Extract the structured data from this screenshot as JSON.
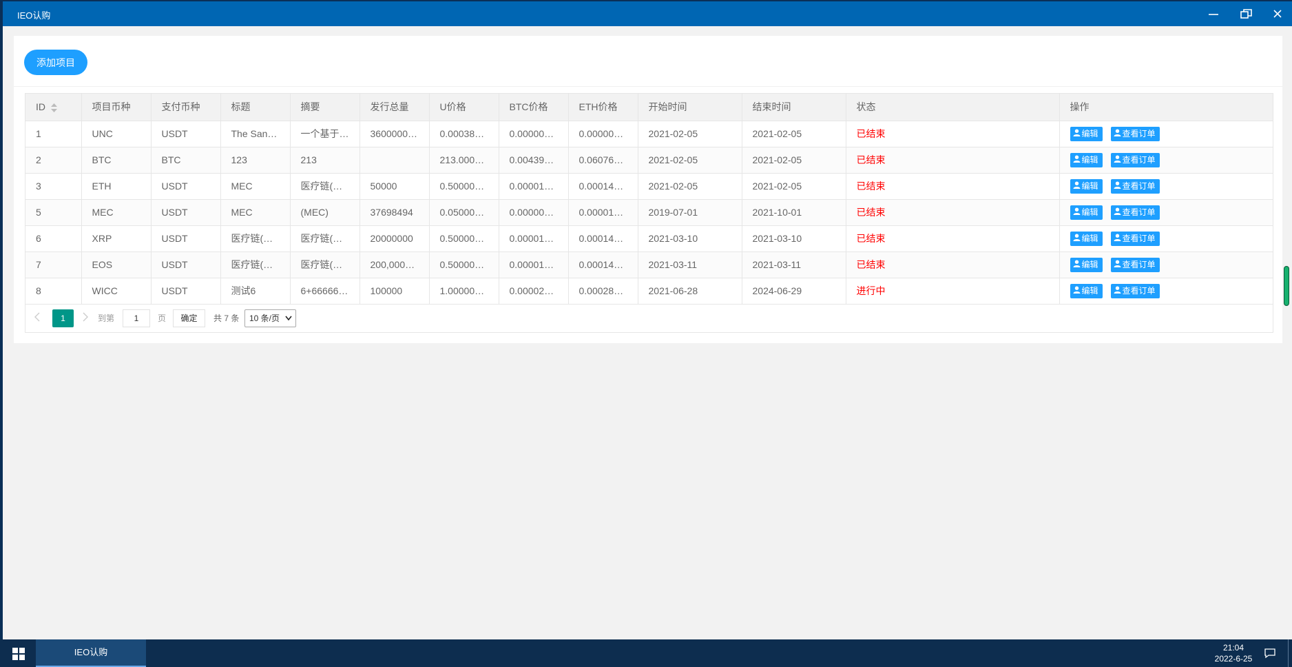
{
  "window": {
    "title": "IEO认购"
  },
  "toolbar": {
    "add_label": "添加项目"
  },
  "table": {
    "headers": [
      "ID",
      "项目币种",
      "支付币种",
      "标题",
      "摘要",
      "发行总量",
      "U价格",
      "BTC价格",
      "ETH价格",
      "开始时间",
      "结束时间",
      "状态",
      "操作"
    ],
    "rows": [
      [
        "1",
        "UNC",
        "USDT",
        "The San…",
        "一个基于…",
        "3600000…",
        "0.00038…",
        "0.00000…",
        "0.00000…",
        "2021-02-05",
        "2021-02-05",
        "已结束"
      ],
      [
        "2",
        "BTC",
        "BTC",
        "123",
        "213",
        "",
        "213.000…",
        "0.00439…",
        "0.06076…",
        "2021-02-05",
        "2021-02-05",
        "已结束"
      ],
      [
        "3",
        "ETH",
        "USDT",
        "MEC",
        "医疗链(…",
        "50000",
        "0.50000…",
        "0.00001…",
        "0.00014…",
        "2021-02-05",
        "2021-02-05",
        "已结束"
      ],
      [
        "5",
        "MEC",
        "USDT",
        "MEC",
        "(MEC)",
        "37698494",
        "0.05000…",
        "0.00000…",
        "0.00001…",
        "2019-07-01",
        "2021-10-01",
        "已结束"
      ],
      [
        "6",
        "XRP",
        "USDT",
        "医疗链(…",
        "医疗链(…",
        "20000000",
        "0.50000…",
        "0.00001…",
        "0.00014…",
        "2021-03-10",
        "2021-03-10",
        "已结束"
      ],
      [
        "7",
        "EOS",
        "USDT",
        "医疗链(…",
        "医疗链(…",
        "200,000…",
        "0.50000…",
        "0.00001…",
        "0.00014…",
        "2021-03-11",
        "2021-03-11",
        "已结束"
      ],
      [
        "8",
        "WICC",
        "USDT",
        "测试6",
        "6+66666…",
        "100000",
        "1.00000…",
        "0.00002…",
        "0.00028…",
        "2021-06-28",
        "2024-06-29",
        "进行中"
      ]
    ],
    "action_edit": "编辑",
    "action_orders": "查看订单"
  },
  "pagination": {
    "current_page": "1",
    "goto_label": "到第",
    "goto_value": "1",
    "page_label": "页",
    "confirm_label": "确定",
    "total_label": "共 7 条",
    "page_size": "10 条/页"
  },
  "taskbar": {
    "app_label": "IEO认购",
    "time": "21:04",
    "date": "2022-6-25"
  },
  "colors": {
    "titlebar": "#0066b3",
    "primary_button": "#1e9fff",
    "status_red": "#ff0000",
    "page_active": "#009688",
    "taskbar": "#0d2d4f"
  },
  "icons": {
    "minimize": "minimize-icon",
    "maximize": "restore-icon",
    "close": "close-icon",
    "sort": "sort-icon",
    "user": "user-icon",
    "prev": "chevron-left-icon",
    "next": "chevron-right-icon",
    "start": "windows-start-icon",
    "notifications": "notification-icon"
  }
}
